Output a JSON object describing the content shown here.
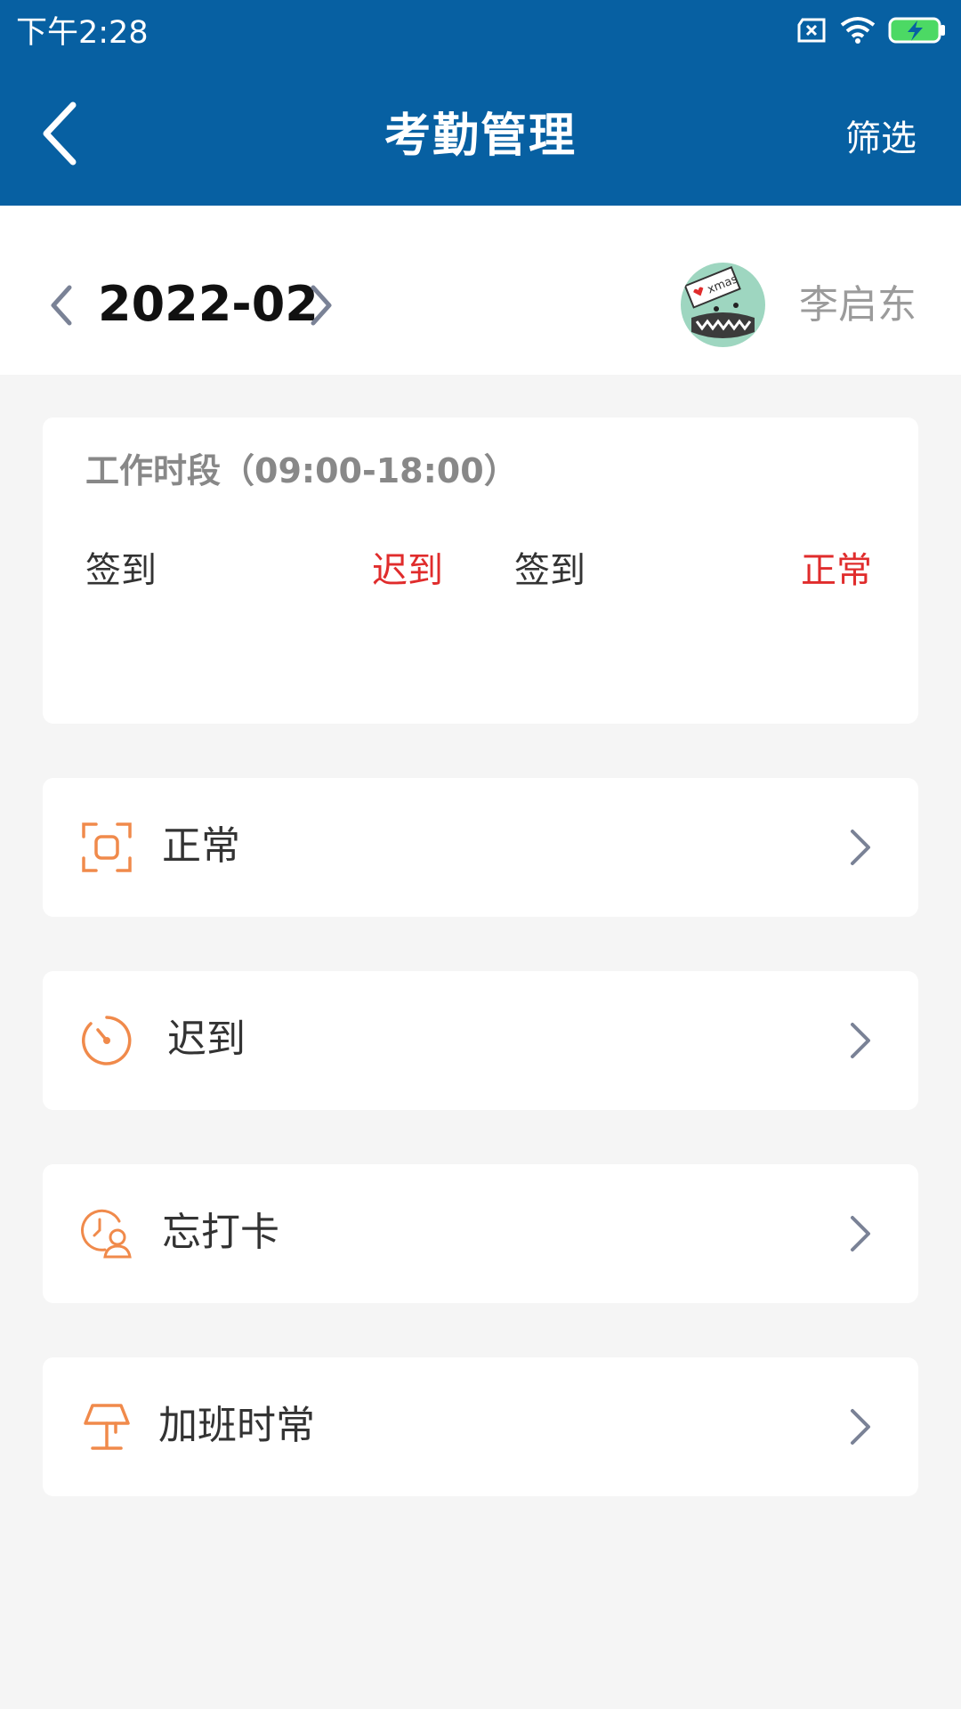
{
  "status_bar": {
    "time": "下午2:28"
  },
  "header": {
    "title": "考勤管理",
    "filter_label": "筛选"
  },
  "month_selector": {
    "month": "2022-02",
    "user_name": "李启东",
    "avatar_text": "xmas"
  },
  "work_card": {
    "title": "工作时段（09:00-18:00）",
    "checkins": [
      {
        "label": "签到",
        "status": "迟到"
      },
      {
        "label": "签到",
        "status": "正常"
      }
    ]
  },
  "categories": [
    {
      "label": "正常",
      "icon": "scan-frame-icon"
    },
    {
      "label": "迟到",
      "icon": "timer-icon"
    },
    {
      "label": "忘打卡",
      "icon": "clock-user-icon"
    },
    {
      "label": "加班时常",
      "icon": "lamp-icon"
    }
  ],
  "colors": {
    "header_bg": "#0760a2",
    "accent_orange": "#f08a4b",
    "status_red": "#e02c2c",
    "page_bg": "#f5f5f5"
  }
}
